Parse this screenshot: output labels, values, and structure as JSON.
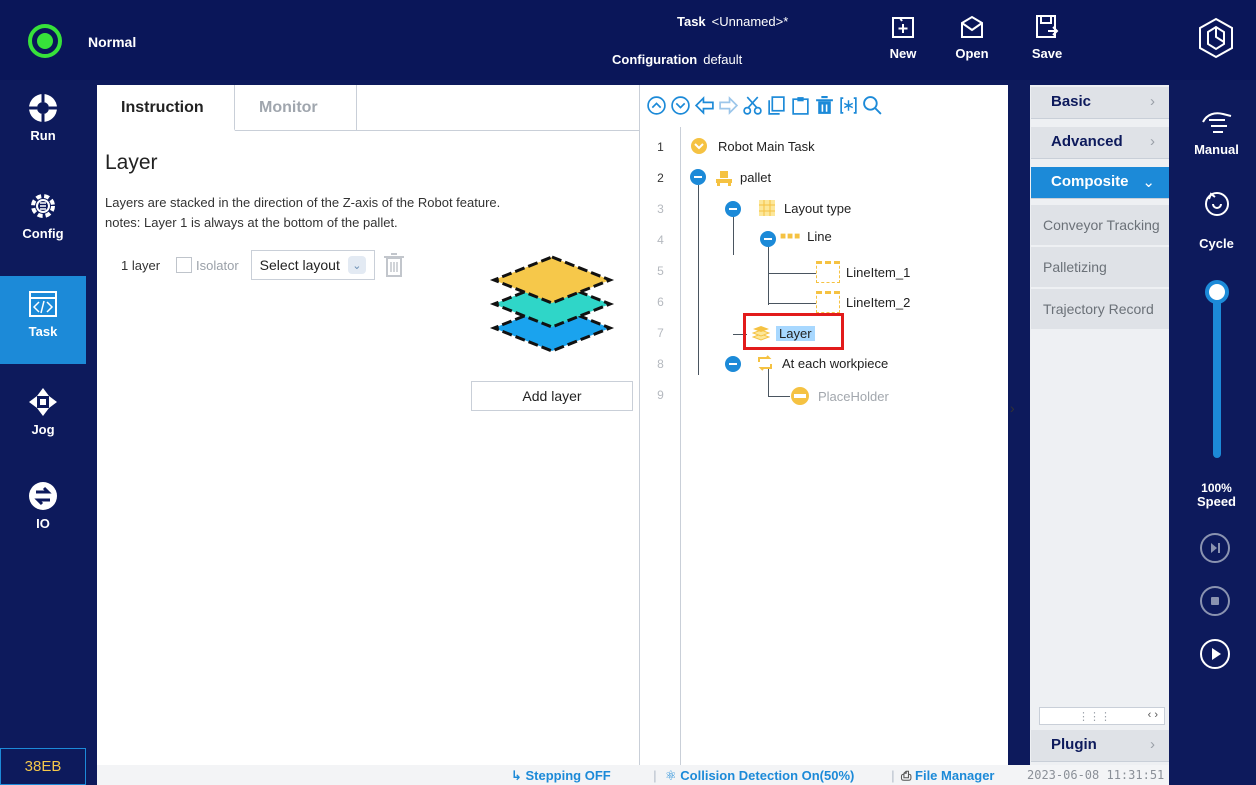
{
  "topbar": {
    "status": "Normal",
    "task_label": "Task",
    "task_value": "<Unnamed>*",
    "config_label": "Configuration",
    "config_value": "default",
    "new_label": "New",
    "open_label": "Open",
    "save_label": "Save"
  },
  "leftnav": {
    "items": [
      {
        "label": "Run",
        "icon": "run-icon"
      },
      {
        "label": "Config",
        "icon": "gear-icon"
      },
      {
        "label": "Task",
        "icon": "code-icon"
      },
      {
        "label": "Jog",
        "icon": "jog-arrows-icon"
      },
      {
        "label": "IO",
        "icon": "io-icon"
      }
    ],
    "active": "Task",
    "version": "38EB"
  },
  "instruction": {
    "tabs": [
      "Instruction",
      "Monitor"
    ],
    "title": "Layer",
    "desc_line1": "Layers are stacked in the direction of the Z-axis of the Robot feature.",
    "desc_line2": "notes: Layer 1 is always at the bottom of the pallet.",
    "row_label": "1 layer",
    "isolator_label": "Isolator",
    "select_value": "Select layout",
    "add_layer_label": "Add layer"
  },
  "tree": {
    "line_numbers": [
      "1",
      "2",
      "3",
      "4",
      "5",
      "6",
      "7",
      "8",
      "9"
    ],
    "nodes": [
      "Robot Main Task",
      "pallet",
      "Layout type",
      "Line",
      "LineItem_1",
      "LineItem_2",
      "Layer",
      "At each workpiece",
      "PlaceHolder"
    ]
  },
  "palette": {
    "basic": "Basic",
    "advanced": "Advanced",
    "composite": "Composite",
    "subs": [
      "Conveyor Tracking",
      "Palletizing",
      "Trajectory Record"
    ],
    "plugin": "Plugin"
  },
  "rightbar": {
    "mode": "Manual",
    "cycle": "Cycle",
    "speed_value": "100%",
    "speed_label": "Speed",
    "speed_fraction": 1.0
  },
  "statusbar": {
    "stepping": "Stepping OFF",
    "collision": "Collision Detection On(50%)",
    "file_manager": "File Manager",
    "datetime": "2023-06-08 11:31:51"
  },
  "colors": {
    "nav_bg": "#0d1a5c",
    "accent": "#1c8ad8",
    "status_green": "#37e23a",
    "node_yellow": "#f5c242",
    "highlight_red": "#e21b1b"
  }
}
